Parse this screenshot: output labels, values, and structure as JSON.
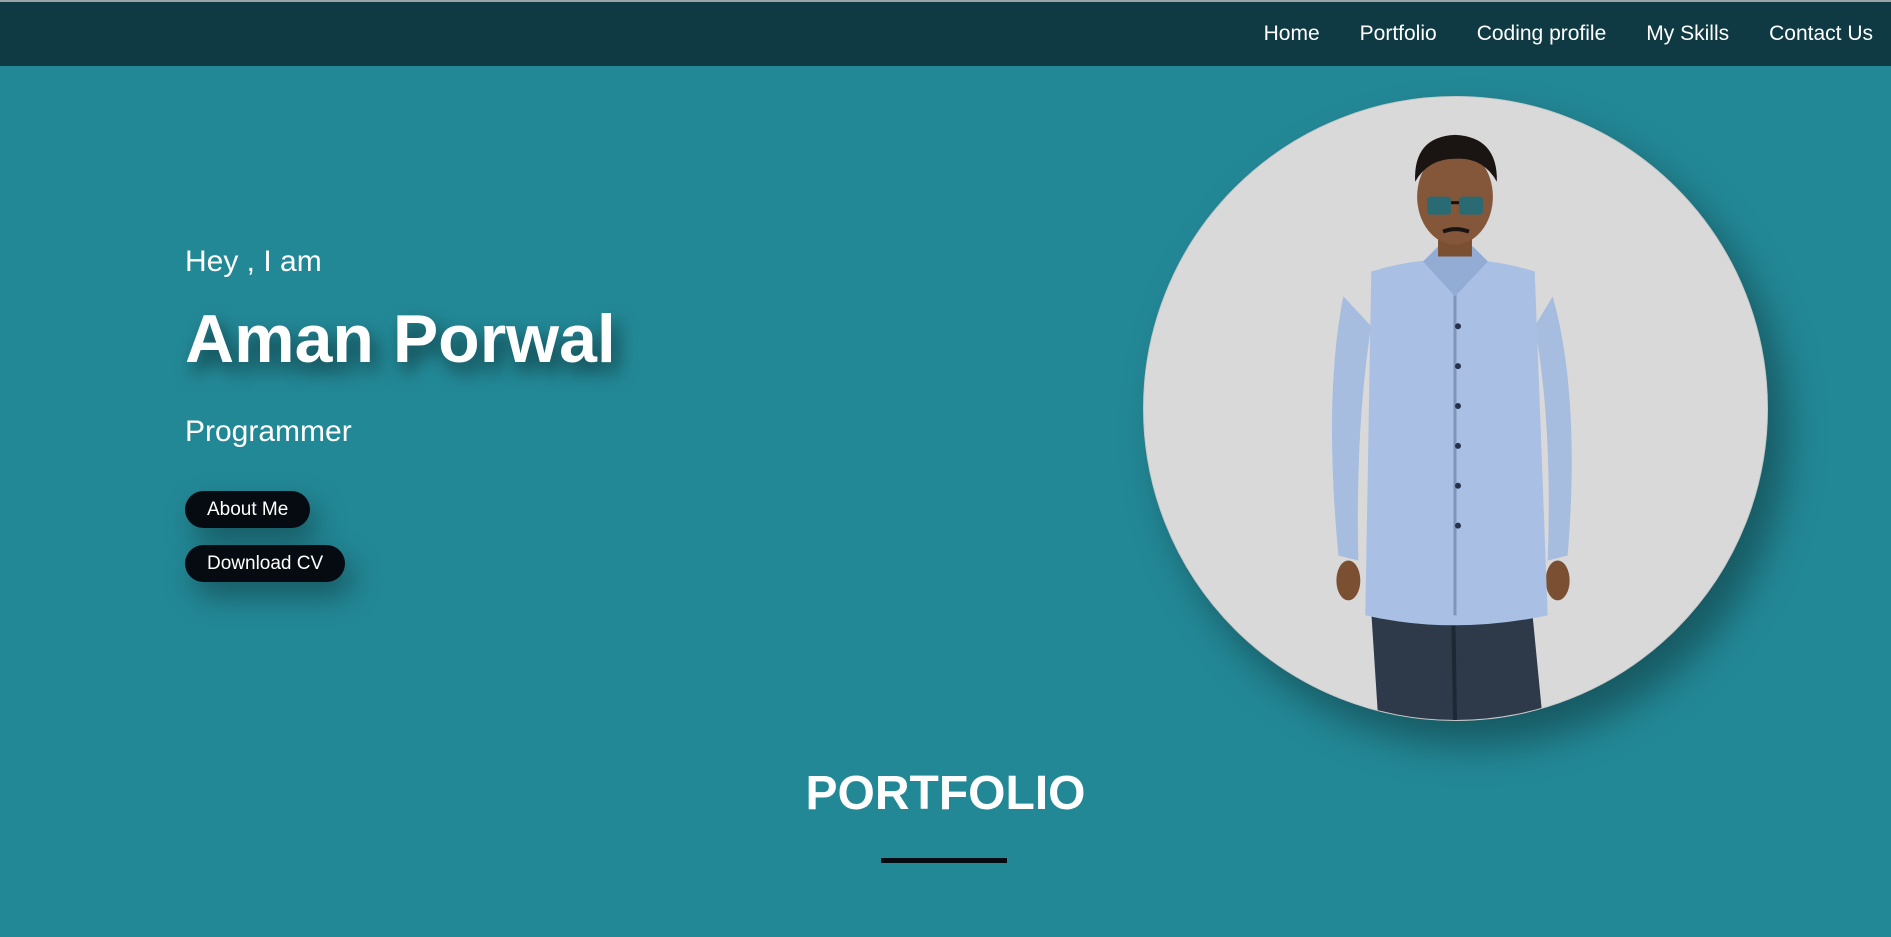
{
  "nav": {
    "items": [
      {
        "label": "Home"
      },
      {
        "label": "Portfolio"
      },
      {
        "label": "Coding profile"
      },
      {
        "label": "My Skills"
      },
      {
        "label": "Contact Us"
      }
    ]
  },
  "hero": {
    "greeting": "Hey , I am",
    "name": "Aman Porwal",
    "role": "Programmer",
    "about_button": "About Me",
    "cv_button": "Download CV"
  },
  "section": {
    "title": "PORTFOLIO"
  },
  "colors": {
    "background": "#238896",
    "navbar": "#0f3a43",
    "button": "#050b10",
    "photo_bg": "#d9d9d9"
  }
}
